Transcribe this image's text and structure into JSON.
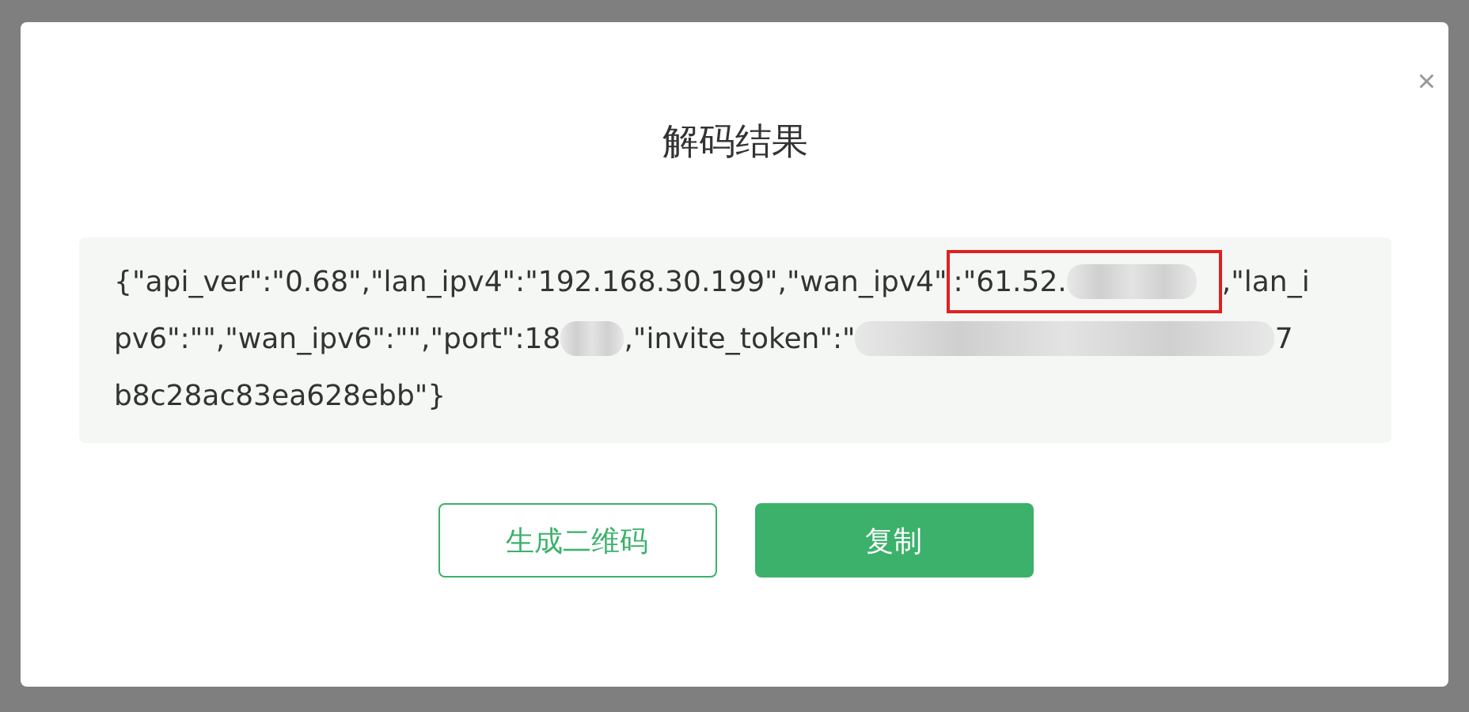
{
  "dialog": {
    "title": "解码结果",
    "close": "×",
    "result_lines": [
      [
        {
          "kind": "text",
          "text": "{\"api_ver\":\"0.68\",\"lan_ipv4\":\"192.168.30.199\",\"wan_ipv4\""
        },
        {
          "kind": "highlight",
          "text": ":\"61.52."
        },
        {
          "kind": "text",
          "text": ",\"lan_i"
        }
      ],
      [
        {
          "kind": "text",
          "text": "pv6\":\"\",\"wan_ipv6\":\"\",\"port\":18"
        },
        {
          "kind": "redacted"
        },
        {
          "kind": "text",
          "text": ",\"invite_token\":\""
        },
        {
          "kind": "redacted"
        },
        {
          "kind": "text",
          "text": "7"
        }
      ],
      [
        {
          "kind": "text",
          "text": "b8c28ac83ea628ebb\"}"
        }
      ]
    ],
    "buttons": [
      {
        "label": "生成二维码",
        "kind": "outline"
      },
      {
        "label": "复制",
        "kind": "primary"
      }
    ]
  }
}
